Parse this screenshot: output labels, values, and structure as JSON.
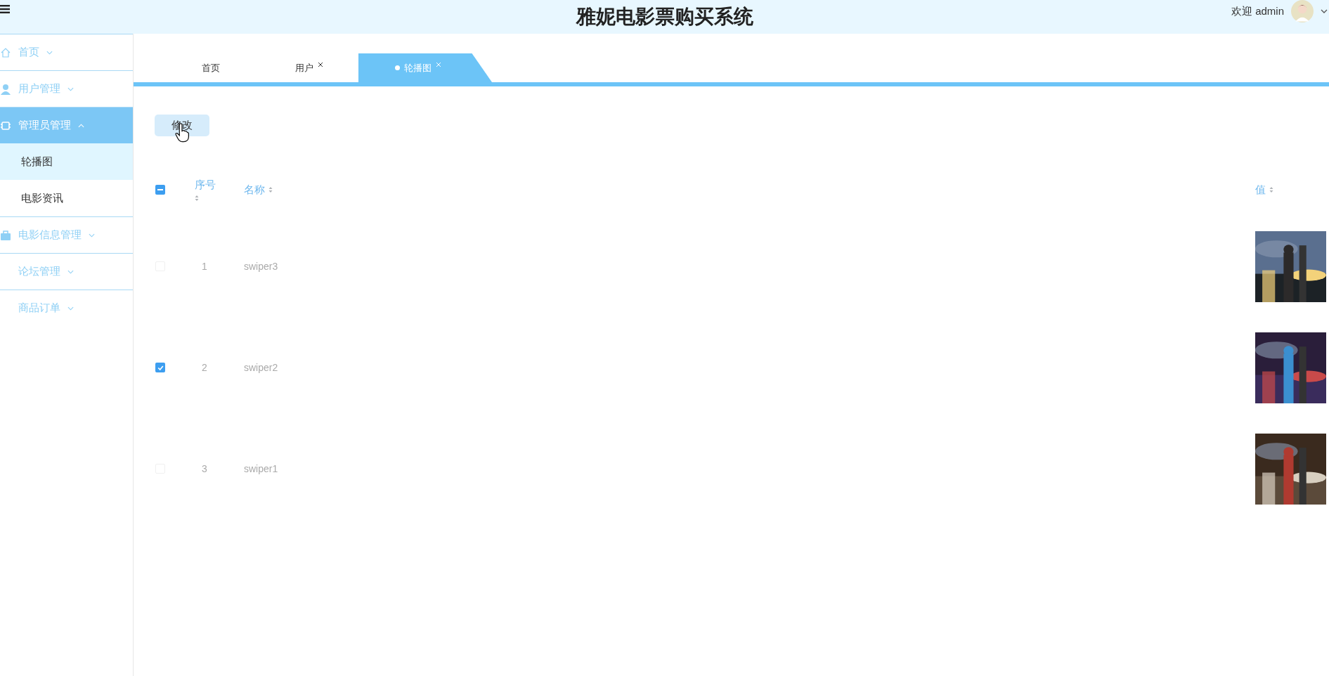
{
  "header": {
    "title": "雅妮电影票购买系统",
    "greeting": "欢迎 admin"
  },
  "sidebar": {
    "items": [
      {
        "label": "首页",
        "kind": "home",
        "expanded": false,
        "selected": false
      },
      {
        "label": "用户管理",
        "kind": "user",
        "expanded": false,
        "selected": false
      },
      {
        "label": "管理员管理",
        "kind": "chip",
        "expanded": true,
        "selected": true,
        "children": [
          {
            "label": "轮播图",
            "selected": true
          },
          {
            "label": "电影资讯",
            "selected": false
          }
        ]
      },
      {
        "label": "电影信息管理",
        "kind": "bag",
        "expanded": false,
        "selected": false
      },
      {
        "label": "论坛管理",
        "kind": "plain",
        "expanded": false,
        "selected": false
      },
      {
        "label": "商品订单",
        "kind": "plain",
        "expanded": false,
        "selected": false
      }
    ]
  },
  "tabs": [
    {
      "label": "首页",
      "closable": false,
      "selected": false
    },
    {
      "label": "用户",
      "closable": true,
      "selected": false
    },
    {
      "label": "轮播图",
      "closable": true,
      "selected": true
    }
  ],
  "toolbar": {
    "button": "修改"
  },
  "table": {
    "select_all": {
      "indeterminate": true
    },
    "columns": [
      {
        "label": "序号",
        "sortable": true
      },
      {
        "label": "名称",
        "sortable": true
      },
      {
        "label": "值",
        "sortable": true
      }
    ],
    "rows": [
      {
        "checked": false,
        "index": "1",
        "name": "swiper3"
      },
      {
        "checked": true,
        "index": "2",
        "name": "swiper2"
      },
      {
        "checked": false,
        "index": "3",
        "name": "swiper1"
      }
    ]
  }
}
